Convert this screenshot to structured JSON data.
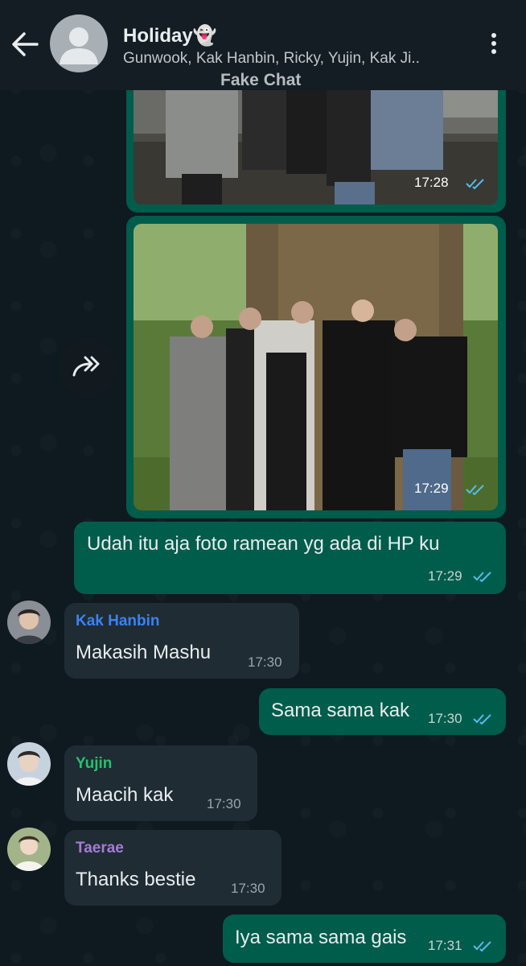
{
  "header": {
    "title": "Holiday👻",
    "subtitle": "Gunwook, Kak Hanbin, Ricky, Yujin, Kak Ji..",
    "watermark": "Fake Chat"
  },
  "messages": [
    {
      "type": "image",
      "direction": "out",
      "time": "17:28",
      "status": "read"
    },
    {
      "type": "image",
      "direction": "out",
      "time": "17:29",
      "status": "read"
    },
    {
      "type": "text",
      "direction": "out",
      "text": "Udah itu aja foto ramean yg ada di HP ku",
      "time": "17:29",
      "status": "read"
    },
    {
      "type": "text",
      "direction": "in",
      "sender": "Kak Hanbin",
      "sender_color": "#3b82f6",
      "text": "Makasih Mashu",
      "time": "17:30"
    },
    {
      "type": "text",
      "direction": "out",
      "text": "Sama sama kak",
      "time": "17:30",
      "status": "read"
    },
    {
      "type": "text",
      "direction": "in",
      "sender": "Yujin",
      "sender_color": "#25c16f",
      "text": "Maacih kak",
      "time": "17:30"
    },
    {
      "type": "text",
      "direction": "in",
      "sender": "Taerae",
      "sender_color": "#a77bd6",
      "text": "Thanks bestie",
      "time": "17:30"
    },
    {
      "type": "text",
      "direction": "out",
      "text": "Iya sama sama gais",
      "time": "17:31",
      "status": "read"
    }
  ],
  "colors": {
    "outgoing": "#005c4b",
    "incoming": "#1f2c33",
    "read_ticks": "#53bdeb"
  }
}
